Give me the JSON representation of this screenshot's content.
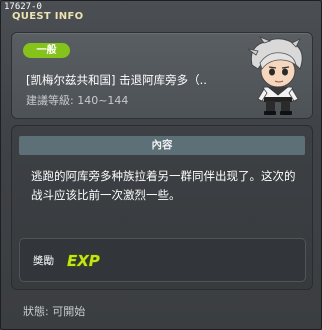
{
  "window": {
    "version_id": "17627-0",
    "title": "QUEST INFO"
  },
  "quest": {
    "category_badge": "一般",
    "name": "[凯梅尔兹共和国] 击退阿库旁多（..",
    "level_range": "建議等級: 140~144"
  },
  "content": {
    "header": "內容",
    "description": "逃跑的阿库旁多种族拉着另一群同伴出现了。这次的战斗应该比前一次激烈一些。"
  },
  "reward": {
    "label": "獎勵",
    "exp_icon_text": "EXP"
  },
  "status": {
    "text": "狀態: 可開始"
  },
  "colors": {
    "badge_green": "#86c21c",
    "title_yellow": "#ece3b0",
    "header_bar": "#5d7078"
  }
}
